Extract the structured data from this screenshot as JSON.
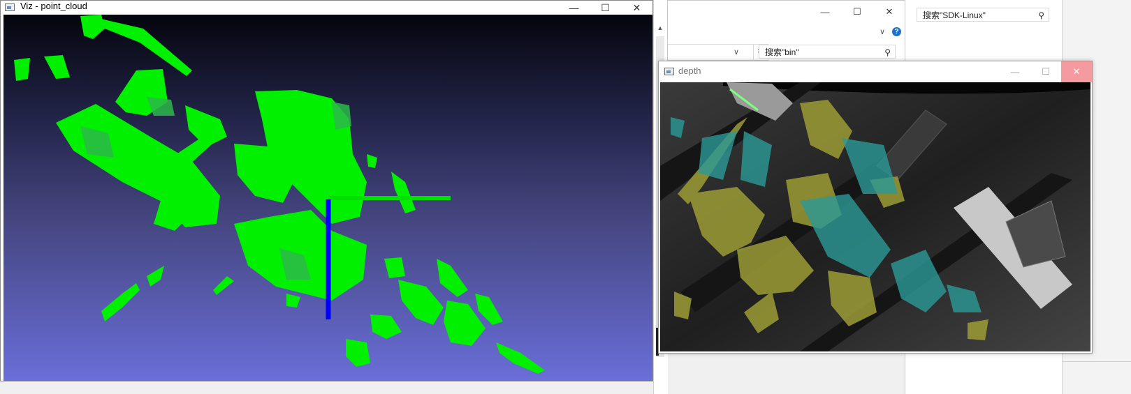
{
  "viz_window": {
    "title": "Viz - point_cloud",
    "caption": {
      "minimize": "—",
      "maximize": "☐",
      "close": "✕"
    },
    "colors": {
      "gradient_top": "#05050e",
      "gradient_bottom": "#6a6ed8",
      "points": "#00ff00",
      "x_axis": "#00e000",
      "z_axis": "#0000ff"
    }
  },
  "explorer_bin": {
    "caption": {
      "minimize": "—",
      "maximize": "☐",
      "close": "✕"
    },
    "chevron": "∨",
    "help": "?",
    "refresh": "↻",
    "search_placeholder": "搜索\"bin\"",
    "search_icon": "⚲"
  },
  "explorer_sdk": {
    "search_placeholder": "搜索\"SDK-Linux\"",
    "search_icon": "⚲"
  },
  "depth_window": {
    "title": "depth",
    "caption": {
      "minimize": "—",
      "maximize": "☐",
      "close": "✕"
    },
    "colors": {
      "background": "#2c2c2c",
      "overlay_yellow": "#a6a63a",
      "overlay_teal": "#2b9a96",
      "panel": "#cfcfcf"
    }
  }
}
